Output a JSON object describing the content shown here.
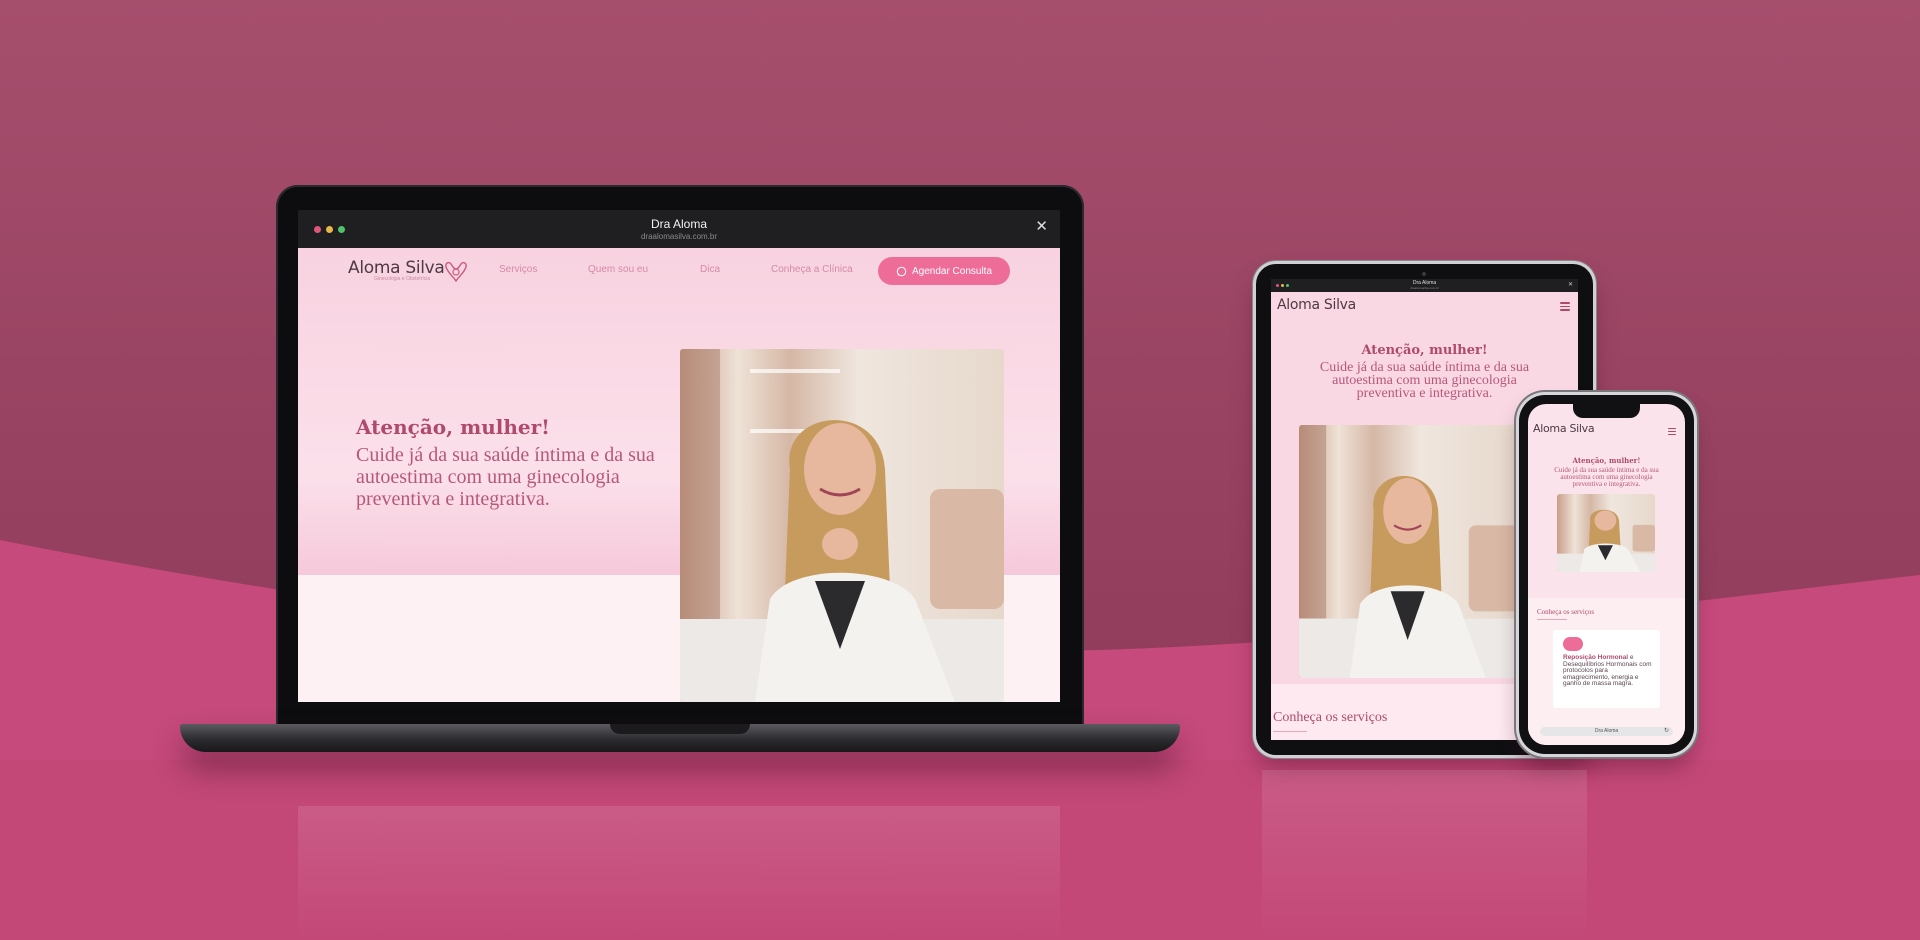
{
  "colors": {
    "background": "#9a4463",
    "floor": "#c64a7c",
    "brand_pink": "#ee6c98",
    "heading": "#b04a6c"
  },
  "laptop": {
    "browser": {
      "title": "Dra Aloma",
      "url": "draalomasilva.com.br",
      "close_icon": "close-icon",
      "window_dots": [
        "#e0567a",
        "#e8b84a",
        "#4dc46a"
      ]
    },
    "site": {
      "logo": {
        "name": "Aloma Silva",
        "tagline": "Ginecologia e Obstetrícia"
      },
      "nav": [
        "Serviços",
        "Quem sou eu",
        "Dica",
        "Conheça a Clínica"
      ],
      "cta": {
        "label": "Agendar Consulta",
        "icon": "whatsapp-icon"
      },
      "hero_title": "Atenção, mulher!",
      "hero_text": "Cuide já da sua saúde íntima e da sua autoestima com uma ginecologia preventiva e integrativa."
    }
  },
  "tablet": {
    "browser": {
      "title": "Dra Aloma",
      "url": "draalomasilva.com.br"
    },
    "logo": "Aloma Silva",
    "menu_icon": "hamburger-icon",
    "hero_title": "Atenção, mulher!",
    "hero_text": "Cuide já da sua saúde íntima e da sua autoestima com uma ginecologia preventiva e integrativa.",
    "section_title": "Conheça os serviços"
  },
  "phone": {
    "logo": "Aloma Silva",
    "menu_icon": "hamburger-icon",
    "hero_title": "Atenção, mulher!",
    "hero_text": "Cuide já da sua saúde íntima e da sua autoestima com uma ginecologia preventiva e integrativa.",
    "section_title": "Conheça os serviços",
    "service_card": {
      "title": "Reposição Hormonal",
      "text": "e Desequilíbrios Hormonais com protocolos para emagrecimento, energia e ganho de massa magra."
    },
    "url_bar": "Dra Aloma"
  }
}
